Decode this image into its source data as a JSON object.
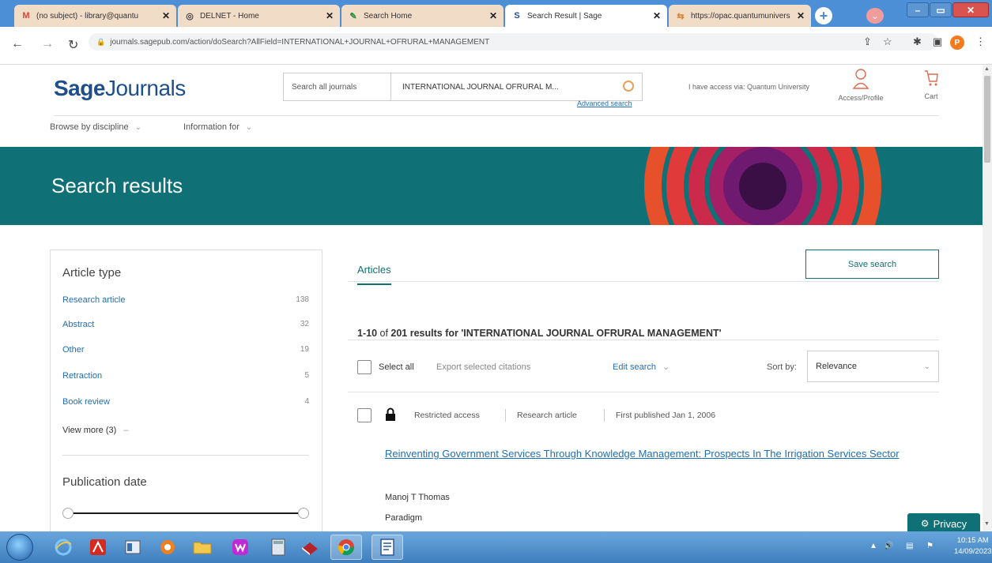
{
  "browser": {
    "tabs": [
      {
        "label": "(no subject) - library@quantu",
        "icon": "M"
      },
      {
        "label": "DELNET - Home",
        "icon": "◎"
      },
      {
        "label": "Search Home",
        "icon": "✎"
      },
      {
        "label": "Search Result | Sage",
        "icon": "S"
      },
      {
        "label": "https://opac.quantumunivers",
        "icon": "⇆"
      }
    ],
    "url": "journals.sagepub.com/action/doSearch?AllField=INTERNATIONAL+JOURNAL+OFRURAL+MANAGEMENT",
    "profile_initial": "P"
  },
  "site": {
    "logo_sage": "Sage",
    "logo_journals": "Journals",
    "search_scope": "Search all journals",
    "search_value": "INTERNATIONAL JOURNAL OFRURAL M...",
    "advanced_search": "Advanced search",
    "access_text": "I have access via:  Quantum University",
    "access_profile": "Access/Profile",
    "cart": "Cart",
    "nav": [
      "Browse by discipline",
      "Information for"
    ]
  },
  "banner": {
    "title": "Search results"
  },
  "facets": {
    "article_type_title": "Article type",
    "items": [
      {
        "label": "Research article",
        "count": "138"
      },
      {
        "label": "Abstract",
        "count": "32"
      },
      {
        "label": "Other",
        "count": "19"
      },
      {
        "label": "Retraction",
        "count": "5"
      },
      {
        "label": "Book review",
        "count": "4"
      }
    ],
    "view_more": "View more (3)",
    "pubdate_title": "Publication date"
  },
  "results": {
    "tab_label": "Articles",
    "save_search": "Save search",
    "count_prefix": "1-10",
    "count_of": " of ",
    "count_total": "201",
    "count_suffix": " results for 'INTERNATIONAL JOURNAL OFRURAL MANAGEMENT'",
    "select_all": "Select all",
    "export_citations": "Export selected citations",
    "edit_search": "Edit search",
    "sort_by_label": "Sort by:",
    "sort_value": "Relevance",
    "article": {
      "access": "Restricted access",
      "type": "Research article",
      "published": "First published Jan 1, 2006",
      "title": "Reinventing Government Services Through Knowledge Management: Prospects In The Irrigation Services Sector",
      "author": "Manoj T Thomas",
      "journal": "Paradigm"
    }
  },
  "privacy_button": "Privacy",
  "taskbar": {
    "time": "10:15 AM",
    "date": "14/09/2023"
  },
  "colors": {
    "brand_blue": "#1f4f8b",
    "teal": "#0f7076",
    "link": "#1f6fb5",
    "taskbar": "#3f7fbf"
  }
}
